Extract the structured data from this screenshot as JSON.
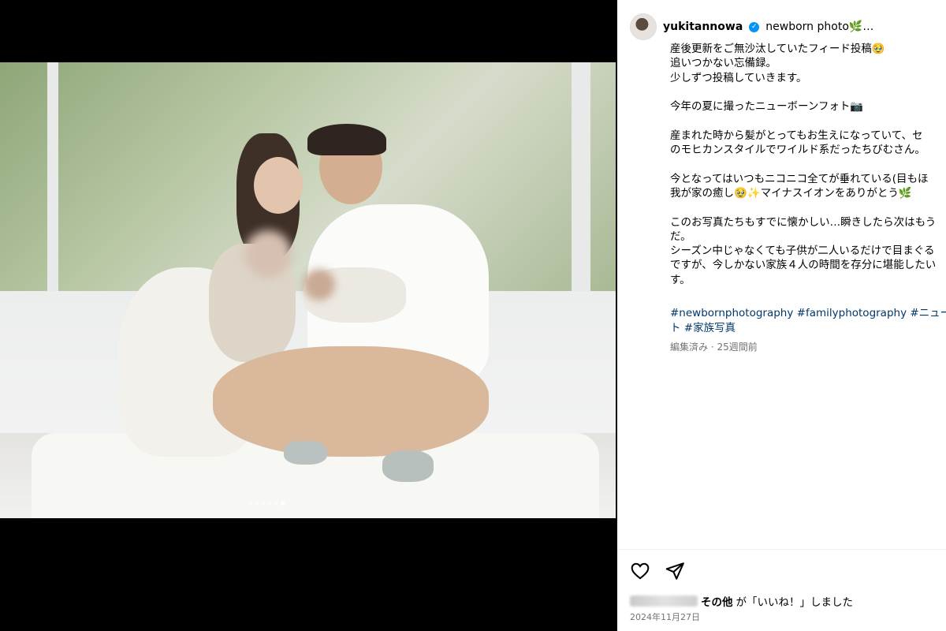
{
  "post": {
    "username": "yukitannowa",
    "header_caption": "newborn photo🌿…",
    "caption": "産後更新をご無沙汰していたフィード投稿🥹\n追いつかない忘備録。\n少しずつ投稿していきます。\n\n今年の夏に撮ったニューボーンフォト📷\n\n産まれた時から髪がとってもお生えになっていて、セ\nのモヒカンスタイルでワイルド系だったちびむさん。\n\n今となってはいつもニコニコ全てが垂れている(目もほ\n我が家の癒し🥹✨マイナスイオンをありがとう🌿\n\nこのお写真たちもすでに懐かしい…瞬きしたら次はもう\nだ。\nシーズン中じゃなくても子供が二人いるだけで目まぐる\nですが、今しかない家族４人の時間を存分に堪能したい\nす。",
    "hashtags": "#newbornphotography #familyphotography #ニュー\nト #家族写真",
    "meta": "編集済み · 25週間前",
    "likes_suffix": "その他",
    "likes_text": "が「いいね！」しました",
    "date": "2024年11月27日"
  },
  "carousel": {
    "count": 6,
    "active_index": 5
  },
  "icons": {
    "like": "heart-icon",
    "share": "paper-plane-icon",
    "verified": "verified-badge-icon"
  },
  "colors": {
    "hashtag": "#00376b",
    "verified": "#0095f6",
    "muted": "#737373"
  }
}
